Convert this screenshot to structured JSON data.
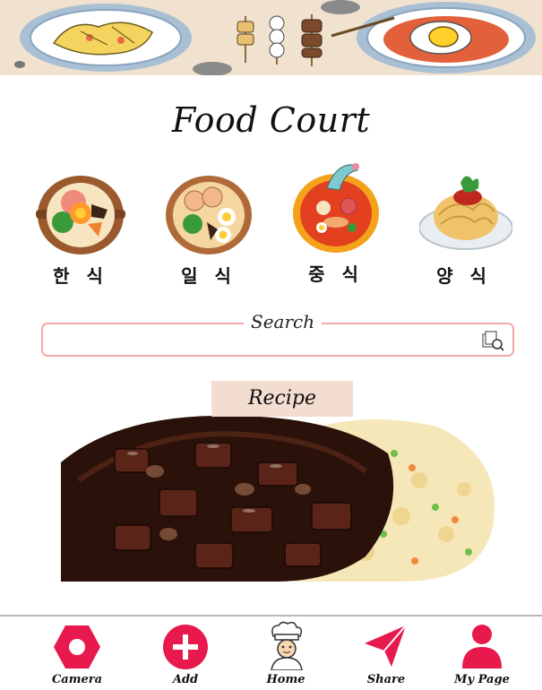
{
  "header": {
    "title": "Food Court"
  },
  "categories": [
    {
      "label": "한 식",
      "icon": "bibimbap-icon"
    },
    {
      "label": "일 식",
      "icon": "ramen-icon"
    },
    {
      "label": "중 식",
      "icon": "jjamppong-icon"
    },
    {
      "label": "양 식",
      "icon": "spaghetti-icon"
    }
  ],
  "search": {
    "label": "Search",
    "placeholder": "",
    "value": ""
  },
  "recipe": {
    "label": "Recipe"
  },
  "nav": {
    "items": [
      {
        "label": "Camera",
        "icon": "camera-icon"
      },
      {
        "label": "Add",
        "icon": "add-icon"
      },
      {
        "label": "Home",
        "icon": "chef-icon"
      },
      {
        "label": "Share",
        "icon": "share-icon"
      },
      {
        "label": "My Page",
        "icon": "user-icon"
      }
    ]
  },
  "colors": {
    "accent": "#e8194d",
    "banner": "#f1e2cf",
    "search_border": "#f1a9a9",
    "recipe_label_bg": "#f3ddd0"
  }
}
